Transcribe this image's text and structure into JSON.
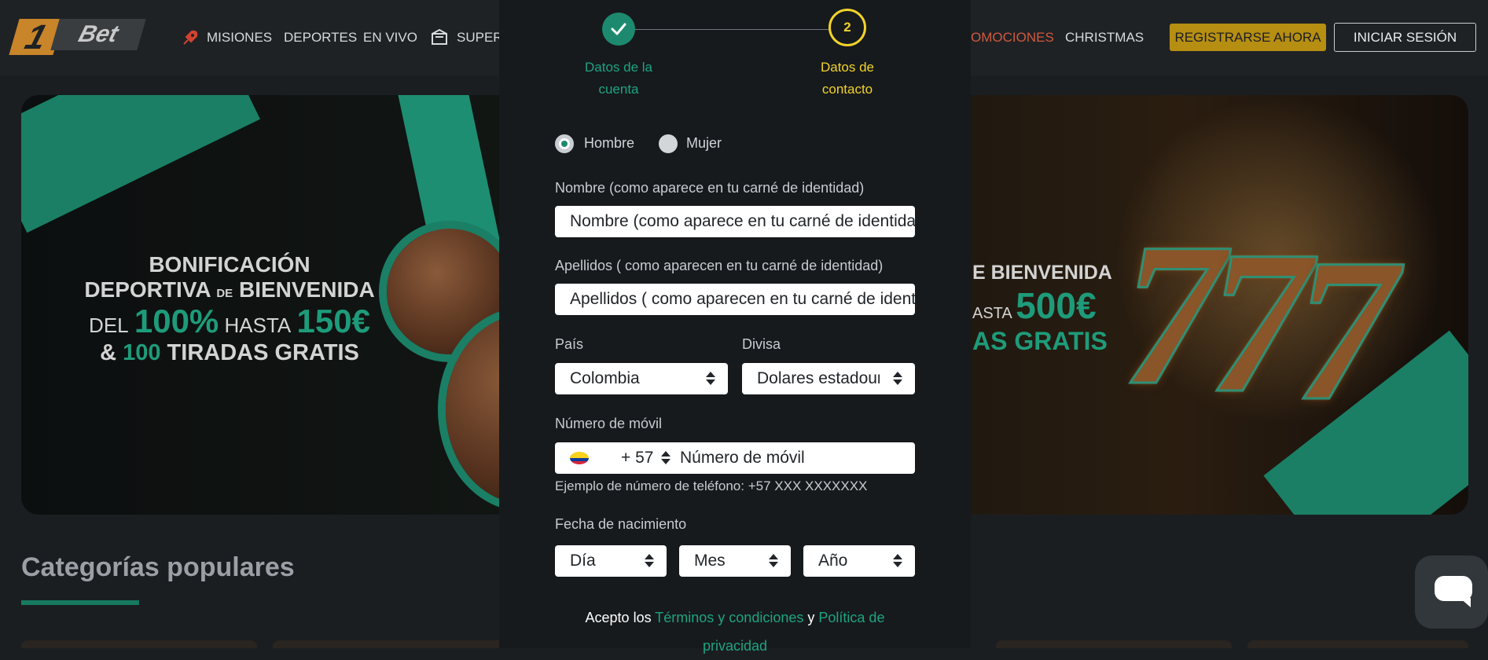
{
  "header": {
    "logo_number": "1",
    "logo_text": "Bet",
    "nav": [
      "MISIONES",
      "DEPORTES",
      "EN VIVO",
      "SUPERP",
      "OMOCIONES",
      "CHRISTMAS"
    ],
    "register_label": "REGISTRARSE AHORA",
    "login_label": "INICIAR SESIÓN"
  },
  "hero": {
    "left_line1": "BONIFICACIÓN",
    "left_line2a": "DEPORTIVA",
    "left_line2b": "DE",
    "left_line2c": "BIENVENIDA",
    "left_line3a": "DEL",
    "left_line3b": "100%",
    "left_line3c": "HASTA",
    "left_line3d": "150€",
    "left_line4a": "&",
    "left_line4b": "100",
    "left_line4c": "TIRADAS GRATIS",
    "right_line1": "E BIENVENIDA",
    "right_line2a": "ASTA",
    "right_line2b": "500€",
    "right_line3": "AS GRATIS"
  },
  "categories": {
    "title": "Categorías populares"
  },
  "registration": {
    "step1_number": "✓",
    "step1_label_a": "Datos de la",
    "step1_label_b": "cuenta",
    "step2_number": "2",
    "step2_label_a": "Datos de",
    "step2_label_b": "contacto",
    "gender_male": "Hombre",
    "gender_female": "Mujer",
    "first_name_label": "Nombre (como aparece en tu carné de identidad)",
    "first_name_placeholder": "Nombre (como aparece en tu carné de identidad)",
    "last_name_label": "Apellidos ( como aparecen en tu carné de identidad)",
    "last_name_placeholder": "Apellidos ( como aparecen en tu carné de identidad)",
    "country_label": "País",
    "country_value": "Colombia",
    "currency_label": "Divisa",
    "currency_value": "Dolares estadounidenses",
    "phone_label": "Número de móvil",
    "phone_code": "+ 57",
    "phone_placeholder": "Número de móvil",
    "phone_hint": "Ejemplo de número de teléfono: +57 XXX XXXXXXX",
    "dob_label": "Fecha de nacimiento",
    "dob_day": "Día",
    "dob_month": "Mes",
    "dob_year": "Año",
    "terms_prefix": "Acepto los",
    "terms_link": "Términos y condiciones",
    "terms_and": "y",
    "privacy_link": "Política de privacidad"
  },
  "icons": [
    "rocket-icon",
    "slot-icon",
    "check-icon",
    "colombia-flag-icon",
    "chat-icon"
  ],
  "colors": {
    "accent_green": "#1d8a6f",
    "step_active": "#f2d22a",
    "register_gold": "#b68e12",
    "promo_red": "#d0593e"
  }
}
